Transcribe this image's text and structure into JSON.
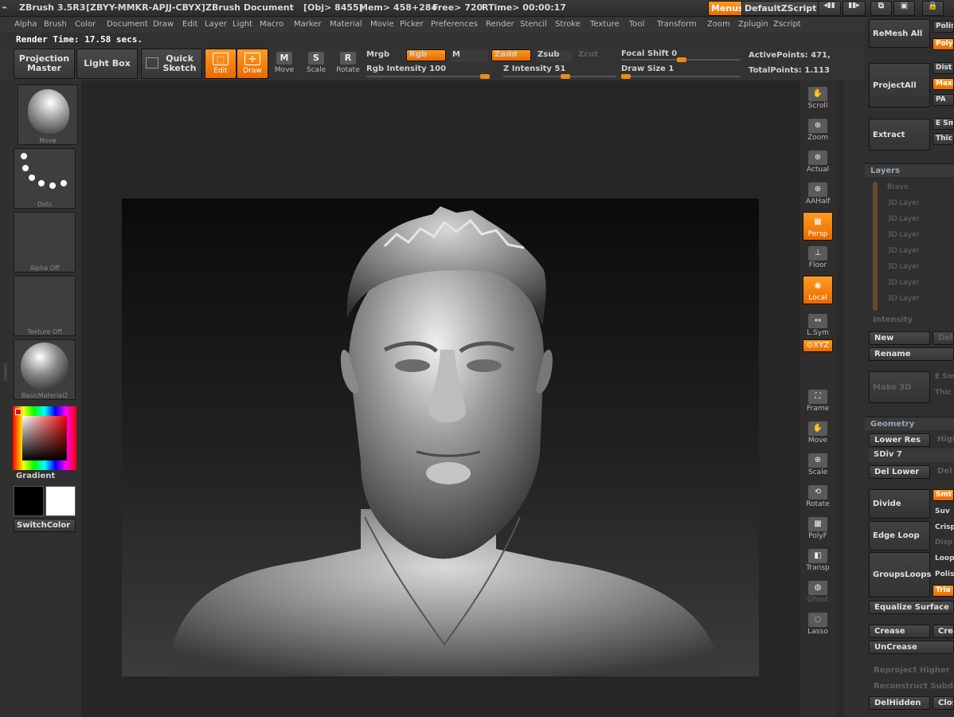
{
  "titlebar": {
    "app_title": "ZBrush 3.5R3",
    "serial": "[ZBYY-MMKR-APJJ-CBYX]",
    "document": "ZBrush Document",
    "obj_info": "[Obj> 8455]",
    "mem": "Mem> 458+284",
    "free": "Free> 720",
    "rtime": "RTime> 00:00:17",
    "menus_button": "Menus",
    "script_button": "DefaultZScript"
  },
  "menubar": [
    "Alpha",
    "Brush",
    "Color",
    "Document",
    "Draw",
    "Edit",
    "Layer",
    "Light",
    "Macro",
    "Marker",
    "Material",
    "Movie",
    "Picker",
    "Preferences",
    "Render",
    "Stencil",
    "Stroke",
    "Texture",
    "Tool",
    "Transform",
    "Zoom",
    "Zplugin",
    "Zscript"
  ],
  "render_time": "Render Time: 17.58 secs.",
  "toolbar": {
    "projection_master": "Projection Master",
    "light_box": "Light Box",
    "quick_sketch": "Quick Sketch",
    "edit": "Edit",
    "draw": "Draw",
    "move": "Move",
    "scale": "Scale",
    "rotate": "Rotate",
    "mrgb": "Mrgb",
    "rgb": "Rgb",
    "m": "M",
    "zadd": "Zadd",
    "zsub": "Zsub",
    "zcut": "Zcut",
    "rgb_intensity": "Rgb Intensity 100",
    "z_intensity": "Z Intensity 51",
    "focal_shift": "Focal Shift 0",
    "draw_size": "Draw Size 1",
    "active_points": "ActivePoints: 471,",
    "total_points": "TotalPoints: 1.113",
    "rgb_intensity_value": 100,
    "z_intensity_value": 51
  },
  "left_shelf": {
    "brush_caption": "Move",
    "stroke_caption": "Dots",
    "alpha_caption": "Alpha  Off",
    "texture_caption": "Texture  Off",
    "material_caption": "BasicMaterial2",
    "gradient_label": "Gradient",
    "switch_color": "SwitchColor"
  },
  "right_shelf": [
    "Scroll",
    "Zoom",
    "Actual",
    "AAHalf",
    "Persp",
    "Floor",
    "Local",
    "L.Sym",
    "Frame",
    "Move",
    "Scale",
    "Rotate",
    "PolyF",
    "Transp",
    "Ghost",
    "Lasso"
  ],
  "right_shelf_xyz": "⊙XYZ",
  "right_panel": {
    "remesh_all": "ReMesh All",
    "polish": "Polis",
    "poly": "Poly",
    "project_all": "ProjectAll",
    "dist": "Dist",
    "maxi": "Maxi",
    "pa": "PA",
    "extract": "Extract",
    "e_sm": "E Sm",
    "thick": "Thic",
    "layers_header": "Layers",
    "layer_bravo": "Bravo",
    "layers": [
      "3D Layer",
      "3D Layer",
      "3D Layer",
      "3D Layer",
      "3D Layer",
      "3D Layer",
      "3D Layer"
    ],
    "intensity": "Intensity",
    "new": "New",
    "delete": "Dele",
    "rename": "Rename",
    "make_3d": "Make 3D",
    "e_sm2": "E Sm",
    "thick2": "Thic",
    "geometry_header": "Geometry",
    "lower_res": "Lower Res",
    "higher": "High",
    "sdiv": "SDiv 7",
    "del_lower": "Del Lower",
    "del_higher": "Del",
    "divide": "Divide",
    "smt": "Smt",
    "suv": "Suv",
    "edge_loop": "Edge Loop",
    "crisp": "Crisp",
    "disp": "Disp",
    "groups_loops": "GroupsLoops",
    "loop": "Loop",
    "polish2": "Polis",
    "tria": "Tria",
    "equalize_surface": "Equalize Surface",
    "crease": "Crease",
    "crease2": "Crea",
    "uncrease": "UnCrease",
    "reproject_higher": "Reproject Higher",
    "reconstruct_subdiv": "Reconstruct Subd",
    "del_hidden": "DelHidden",
    "close": "Close"
  },
  "colors": {
    "accent": "#f07d00",
    "panel": "#303030",
    "viewport_bg": "#262626"
  }
}
